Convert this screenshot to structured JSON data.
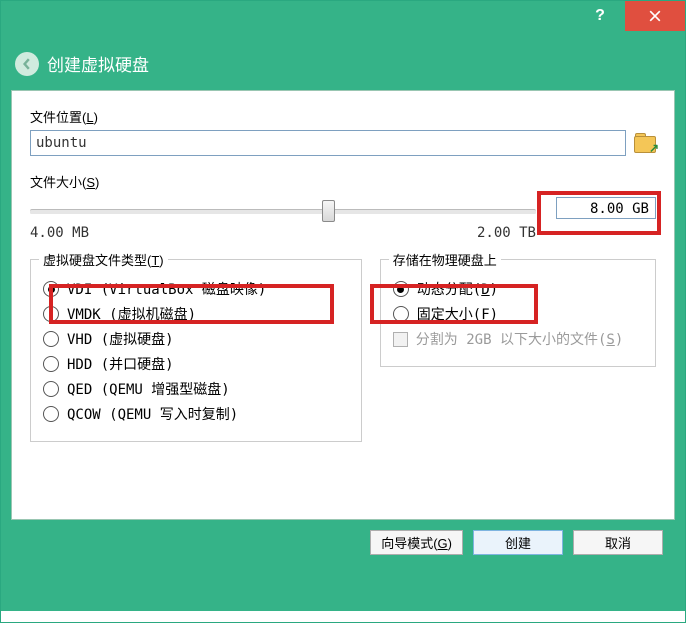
{
  "titlebar": {
    "help_glyph": "?",
    "close_aria": "Close"
  },
  "header": {
    "title": "创建虚拟硬盘"
  },
  "location": {
    "label_pre": "文件位置(",
    "accel": "L",
    "label_post": ")",
    "value": "ubuntu"
  },
  "size": {
    "label_pre": "文件大小(",
    "accel": "S",
    "label_post": ")",
    "display": "8.00 GB",
    "min": "4.00 MB",
    "max": "2.00 TB"
  },
  "filetype": {
    "legend_pre": "虚拟硬盘文件类型(",
    "accel": "T",
    "legend_post": ")",
    "options": [
      {
        "label": "VDI (VirtualBox 磁盘映像)",
        "checked": true
      },
      {
        "label": "VMDK (虚拟机磁盘)",
        "checked": false
      },
      {
        "label": "VHD (虚拟硬盘)",
        "checked": false
      },
      {
        "label": "HDD (并口硬盘)",
        "checked": false
      },
      {
        "label": "QED (QEMU 增强型磁盘)",
        "checked": false
      },
      {
        "label": "QCOW (QEMU 写入时复制)",
        "checked": false
      }
    ]
  },
  "storage": {
    "legend": "存储在物理硬盘上",
    "options": [
      {
        "pre": "动态分配(",
        "accel": "D",
        "post": ")",
        "checked": true
      },
      {
        "pre": "固定大小(",
        "accel": "F",
        "post": ")",
        "checked": false
      }
    ],
    "split_pre": "分割为 2GB 以下大小的文件(",
    "split_accel": "S",
    "split_post": ")"
  },
  "buttons": {
    "guided_pre": "向导模式(",
    "guided_accel": "G",
    "guided_post": ")",
    "create": "创建",
    "cancel": "取消"
  }
}
